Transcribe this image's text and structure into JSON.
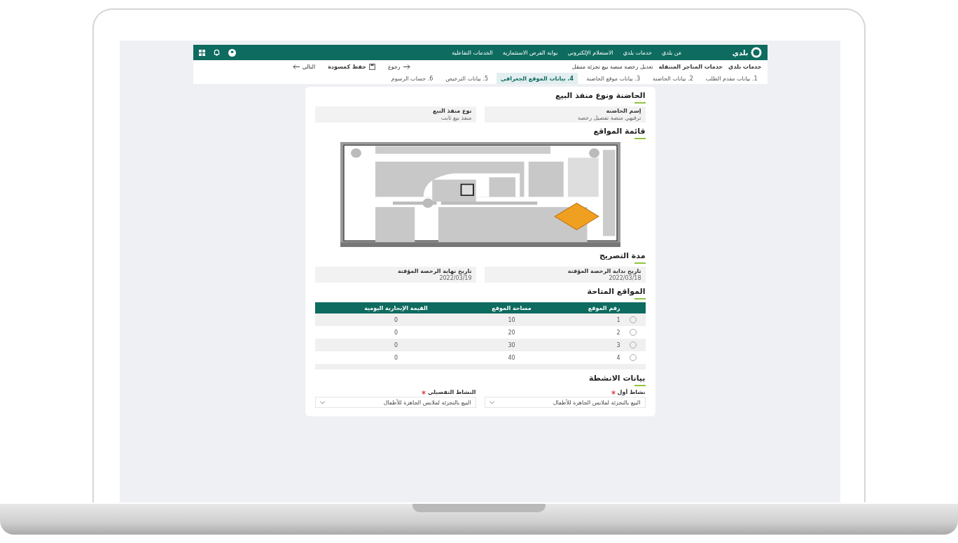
{
  "header": {
    "logo": "بلدي",
    "nav": [
      "عن بلدي",
      "خدمات بلدي",
      "الاستعلام الإلكتروني",
      "بوابة الفرص الاستثمارية",
      "الخدمات التفاعلية"
    ]
  },
  "breadcrumb": [
    "خدمات بلدي",
    "خدمات المتاجر المتنقلة",
    "تعديل رخصة منصة بيع تجزئة متنقل"
  ],
  "actions": {
    "back": "رجوع",
    "save_draft": "حفظ كمسودة",
    "next": "التالي"
  },
  "steps": [
    {
      "label": "1. بيانات مقدم الطلب",
      "selected": false
    },
    {
      "label": "2. بيانات الحاضنة",
      "selected": false
    },
    {
      "label": "3. بيانات موقع الحاضنة",
      "selected": false
    },
    {
      "label": "4. بيانات الموقع الجغرافي",
      "selected": true
    },
    {
      "label": "5. بيانات الترخيص",
      "selected": false
    },
    {
      "label": "6. حساب الرسوم",
      "selected": false
    }
  ],
  "incubator_section": {
    "title": "الحاضنة ونوع منفذ البيع",
    "fields": [
      {
        "label": "إسم الحاضنة",
        "value": "ترفيهي منصة تفصيل رخصة"
      },
      {
        "label": "نوع منفذ البيع",
        "value": "منفذ بيع ثابت"
      }
    ]
  },
  "locations_section": {
    "title": "قائمة المواقع"
  },
  "permit_section": {
    "title": "مدة التصريح",
    "fields": [
      {
        "label": "تاريخ بداية الرخصة المؤقتة",
        "value": "2022/03/18"
      },
      {
        "label": "تاريخ نهاية الرخصة المؤقتة",
        "value": "2022/03/19"
      }
    ]
  },
  "available_sites": {
    "title": "المواقع المتاحة",
    "columns": [
      "رقم الموقع",
      "مساحة الموقع",
      "القيمة الإيجارية اليومية"
    ],
    "rows": [
      {
        "cells": [
          "1",
          "10",
          "0"
        ],
        "selected": false
      },
      {
        "cells": [
          "2",
          "20",
          "0"
        ],
        "selected": false
      },
      {
        "cells": [
          "3",
          "30",
          "0"
        ],
        "selected": false
      },
      {
        "cells": [
          "4",
          "40",
          "0"
        ],
        "selected": false
      }
    ]
  },
  "activities_section": {
    "title": "بيانات الانشطة",
    "fields": [
      {
        "label": "نشاط أول",
        "required": true,
        "value": "البيع بالتجزئة لملابس الجاهزة للأطفال"
      },
      {
        "label": "النشاط التفصيلي",
        "required": true,
        "value": "البيع بالتجزئة لملابس الجاهزة للأطفال"
      }
    ]
  }
}
